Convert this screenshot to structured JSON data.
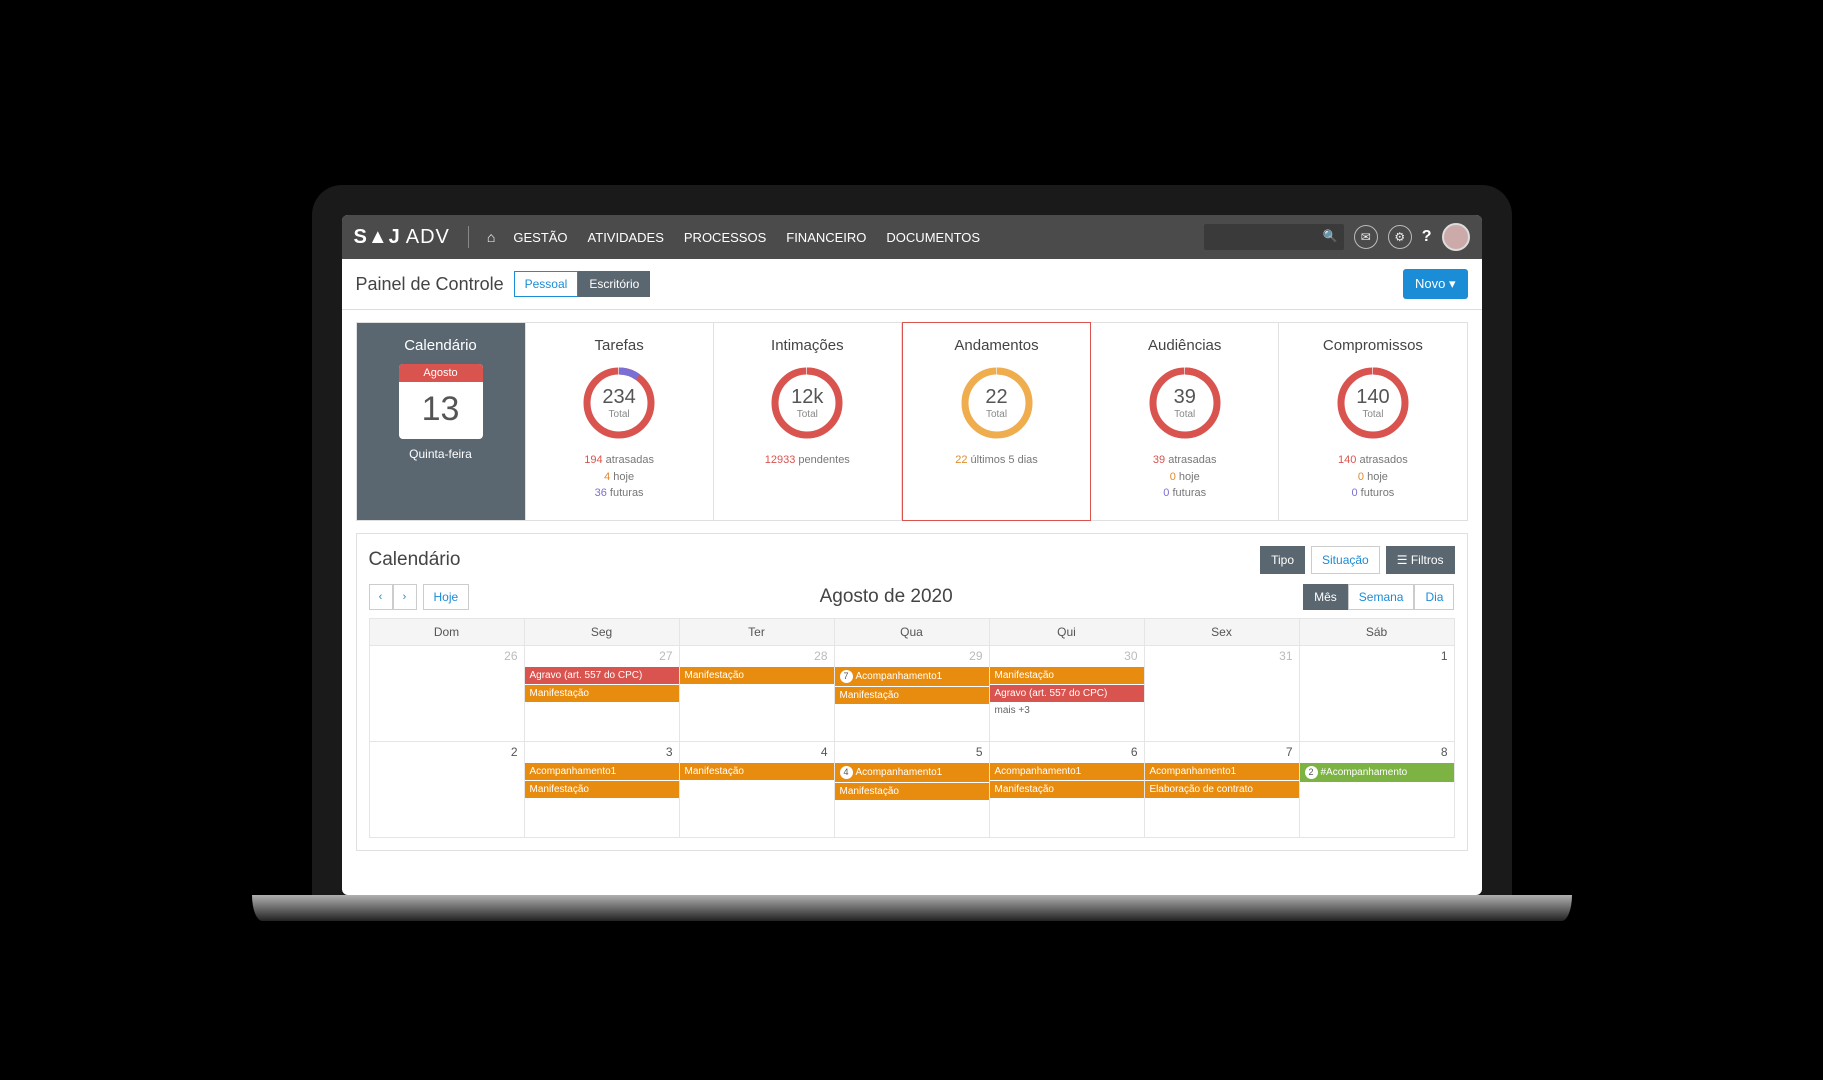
{
  "nav": {
    "logo": "S▲J",
    "logo2": "ADV",
    "items": [
      "GESTÃO",
      "ATIVIDADES",
      "PROCESSOS",
      "FINANCEIRO",
      "DOCUMENTOS"
    ]
  },
  "subheader": {
    "title": "Painel de Controle",
    "tab_pessoal": "Pessoal",
    "tab_escritorio": "Escritório",
    "novo": "Novo"
  },
  "minical": {
    "title": "Calendário",
    "month": "Agosto",
    "day": "13",
    "dow": "Quinta-feira"
  },
  "cards": [
    {
      "title": "Tarefas",
      "value": "234",
      "sub": "Total",
      "color1": "#d9534f",
      "color2": "#7a6fd4",
      "lines": [
        {
          "n": "194",
          "t": " atrasadas",
          "cls": "c-red"
        },
        {
          "n": "4",
          "t": " hoje",
          "cls": "c-orange"
        },
        {
          "n": "36",
          "t": " futuras",
          "cls": "c-purple"
        }
      ]
    },
    {
      "title": "Intimações",
      "value": "12k",
      "sub": "Total",
      "color1": "#d9534f",
      "color2": "#d9534f",
      "lines": [
        {
          "n": "12933",
          "t": " pendentes",
          "cls": "c-red"
        }
      ]
    },
    {
      "title": "Andamentos",
      "value": "22",
      "sub": "Total",
      "highlight": true,
      "color1": "#f0ad4e",
      "color2": "#f0ad4e",
      "lines": [
        {
          "n": "22",
          "t": " últimos 5 dias",
          "cls": "c-orange"
        }
      ]
    },
    {
      "title": "Audiências",
      "value": "39",
      "sub": "Total",
      "color1": "#d9534f",
      "color2": "#d9534f",
      "lines": [
        {
          "n": "39",
          "t": " atrasadas",
          "cls": "c-red"
        },
        {
          "n": "0",
          "t": " hoje",
          "cls": "c-orange"
        },
        {
          "n": "0",
          "t": " futuras",
          "cls": "c-purple"
        }
      ]
    },
    {
      "title": "Compromissos",
      "value": "140",
      "sub": "Total",
      "color1": "#d9534f",
      "color2": "#d9534f",
      "lines": [
        {
          "n": "140",
          "t": " atrasados",
          "cls": "c-red"
        },
        {
          "n": "0",
          "t": " hoje",
          "cls": "c-orange"
        },
        {
          "n": "0",
          "t": " futuros",
          "cls": "c-purple"
        }
      ]
    }
  ],
  "calendar": {
    "title": "Calendário",
    "btn_tipo": "Tipo",
    "btn_situacao": "Situação",
    "btn_filtros": "Filtros",
    "icon_filtros": "☰",
    "today": "Hoje",
    "month_title": "Agosto de 2020",
    "view_mes": "Mês",
    "view_semana": "Semana",
    "view_dia": "Dia",
    "dows": [
      "Dom",
      "Seg",
      "Ter",
      "Qua",
      "Qui",
      "Sex",
      "Sáb"
    ],
    "weeks": [
      {
        "days": [
          {
            "num": "26",
            "muted": true,
            "events": []
          },
          {
            "num": "27",
            "muted": true,
            "events": [
              {
                "cls": "red",
                "text": "Agravo (art. 557 do CPC)"
              },
              {
                "cls": "orange",
                "text": "Manifestação"
              }
            ]
          },
          {
            "num": "28",
            "muted": true,
            "events": [
              {
                "cls": "orange",
                "text": "Manifestação"
              }
            ]
          },
          {
            "num": "29",
            "muted": true,
            "events": [
              {
                "cls": "orange",
                "badge": "7",
                "text": "Acompanhamento1"
              },
              {
                "cls": "orange",
                "text": "Manifestação"
              }
            ]
          },
          {
            "num": "30",
            "muted": true,
            "events": [
              {
                "cls": "orange",
                "text": "Manifestação"
              },
              {
                "cls": "red",
                "text": "Agravo (art. 557 do CPC)"
              }
            ],
            "more": "mais +3"
          },
          {
            "num": "31",
            "muted": true,
            "events": []
          },
          {
            "num": "1",
            "events": []
          }
        ]
      },
      {
        "days": [
          {
            "num": "2",
            "events": []
          },
          {
            "num": "3",
            "events": [
              {
                "cls": "orange",
                "text": "Acompanhamento1"
              },
              {
                "cls": "orange",
                "text": "Manifestação"
              }
            ]
          },
          {
            "num": "4",
            "events": [
              {
                "cls": "orange",
                "text": "Manifestação"
              }
            ]
          },
          {
            "num": "5",
            "events": [
              {
                "cls": "orange",
                "badge": "4",
                "text": "Acompanhamento1"
              },
              {
                "cls": "orange",
                "text": "Manifestação"
              }
            ]
          },
          {
            "num": "6",
            "events": [
              {
                "cls": "orange",
                "text": "Acompanhamento1"
              },
              {
                "cls": "orange",
                "text": "Manifestação"
              }
            ]
          },
          {
            "num": "7",
            "events": [
              {
                "cls": "orange",
                "text": "Acompanhamento1"
              },
              {
                "cls": "orange",
                "text": "Elaboração de contrato"
              }
            ]
          },
          {
            "num": "8",
            "events": [
              {
                "cls": "green",
                "badge": "2",
                "text": "#Acompanhamento"
              }
            ]
          }
        ]
      }
    ]
  }
}
